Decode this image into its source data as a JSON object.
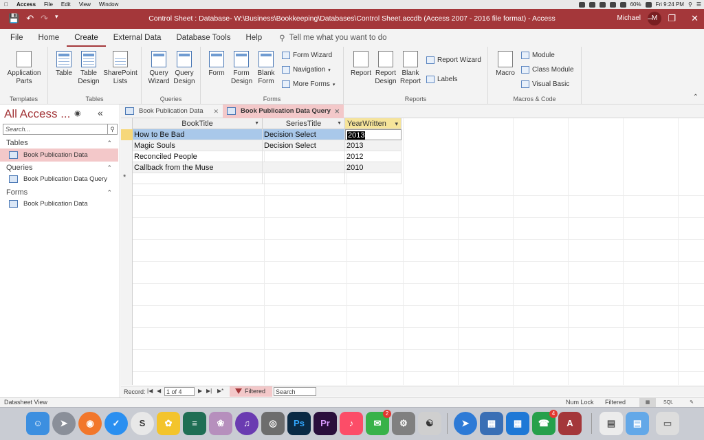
{
  "mac_menu": {
    "app": "Access",
    "items": [
      "File",
      "Edit",
      "View",
      "Window"
    ],
    "battery": "60%",
    "clock": "Fri 9:24 PM"
  },
  "window": {
    "title": "Control Sheet : Database- W:\\Business\\Bookkeeping\\Databases\\Control Sheet.accdb (Access 2007 - 2016 file format)  -  Access",
    "user": "Michael",
    "avatar": "M"
  },
  "ribbon_tabs": [
    "File",
    "Home",
    "Create",
    "External Data",
    "Database Tools",
    "Help"
  ],
  "active_tab": "Create",
  "tell_me": "Tell me what you want to do",
  "ribbon": {
    "templates": {
      "label": "Templates",
      "application_parts": "Application Parts"
    },
    "tables": {
      "label": "Tables",
      "table": "Table",
      "table_design": "Table Design",
      "sharepoint_lists": "SharePoint Lists"
    },
    "queries": {
      "label": "Queries",
      "query_wizard": "Query Wizard",
      "query_design": "Query Design"
    },
    "forms": {
      "label": "Forms",
      "form": "Form",
      "form_design": "Form Design",
      "blank_form": "Blank Form",
      "form_wizard": "Form Wizard",
      "navigation": "Navigation",
      "more_forms": "More Forms"
    },
    "reports": {
      "label": "Reports",
      "report": "Report",
      "report_design": "Report Design",
      "blank_report": "Blank Report",
      "report_wizard": "Report Wizard",
      "labels": "Labels"
    },
    "macros": {
      "label": "Macros & Code",
      "macro": "Macro",
      "module": "Module",
      "class_module": "Class Module",
      "visual_basic": "Visual Basic"
    }
  },
  "nav_pane": {
    "title": "All Access ...",
    "search_placeholder": "Search...",
    "sections": [
      {
        "name": "Tables",
        "items": [
          "Book Publication Data"
        ]
      },
      {
        "name": "Queries",
        "items": [
          "Book Publication Data Query"
        ]
      },
      {
        "name": "Forms",
        "items": [
          "Book Publication Data"
        ]
      }
    ]
  },
  "doc_tabs": [
    {
      "label": "Book Publication Data",
      "active": false
    },
    {
      "label": "Book Publication Data Query",
      "active": true
    }
  ],
  "datasheet": {
    "columns": [
      "BookTitle",
      "SeriesTitle",
      "YearWritten"
    ],
    "rows": [
      [
        "How to Be Bad",
        "Decision Select",
        "2013"
      ],
      [
        "Magic Souls",
        "Decision Select",
        "2013"
      ],
      [
        "Reconciled People",
        "",
        "2012"
      ],
      [
        "Callback from the Muse",
        "",
        "2010"
      ]
    ],
    "new_row_marker": "*"
  },
  "record_nav": {
    "label": "Record:",
    "position": "1 of 4",
    "filter": "Filtered",
    "search": "Search"
  },
  "status": {
    "left": "Datasheet View",
    "num_lock": "Num Lock",
    "filtered": "Filtered",
    "sql": "SQL"
  },
  "dock": {
    "apps": [
      "finder",
      "launchpad",
      "firefox",
      "mail",
      "scrivener",
      "tes",
      "books",
      "lotus",
      "audio",
      "dvd",
      "photoshop",
      "premiere",
      "music",
      "messages",
      "preferences",
      "migration",
      "backup",
      "parallels",
      "windows",
      "office",
      "facetime",
      "access",
      "files",
      "folder",
      "trash"
    ],
    "badges": {
      "messages": "2",
      "facetime": "4"
    }
  }
}
